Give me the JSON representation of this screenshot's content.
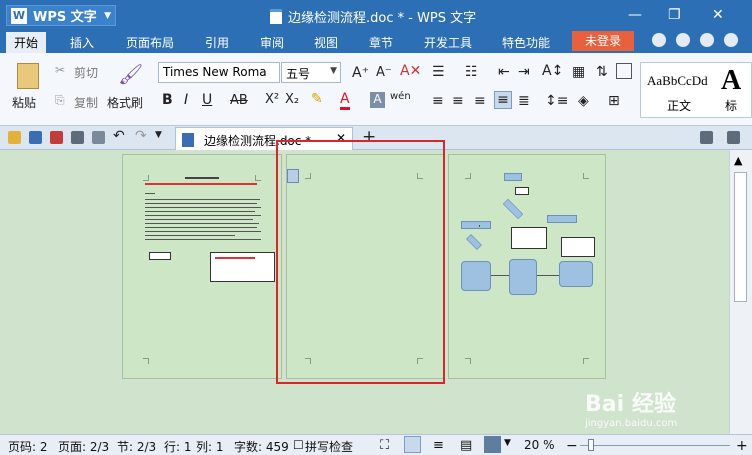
{
  "app": {
    "brand": "WPS 文字",
    "logo_letter": "W",
    "window_title": "边缘检测流程.doc * - WPS 文字"
  },
  "menu": {
    "items": [
      "开始",
      "插入",
      "页面布局",
      "引用",
      "审阅",
      "视图",
      "章节",
      "开发工具",
      "特色功能"
    ],
    "login_label": "未登录"
  },
  "ribbon": {
    "paste_label": "粘贴",
    "cut_label": "剪切",
    "copy_label": "复制",
    "format_painter_label": "格式刷",
    "font_name": "Times New Roma",
    "font_size": "五号",
    "style_preview": "AaBbCcDd",
    "style_name": "正文",
    "style_preview2": "A",
    "style_name2": "标"
  },
  "tabs": {
    "doc_tab_label": "边缘检测流程.doc *"
  },
  "status": {
    "page_num": "页码: 2",
    "page_count": "页面: 2/3",
    "section": "节: 2/3",
    "row": "行: 1",
    "col": "列: 1",
    "word_count": "字数: 459",
    "spell_check": "拼写检查",
    "zoom": "20 %"
  },
  "watermark": "Bai 经验",
  "watermark_url": "jingyan.baidu.com",
  "colors": {
    "title_bar": "#2d6fb5",
    "login": "#e8603c",
    "highlight_box": "#d9262c",
    "page_bg": "#cde6c6"
  }
}
